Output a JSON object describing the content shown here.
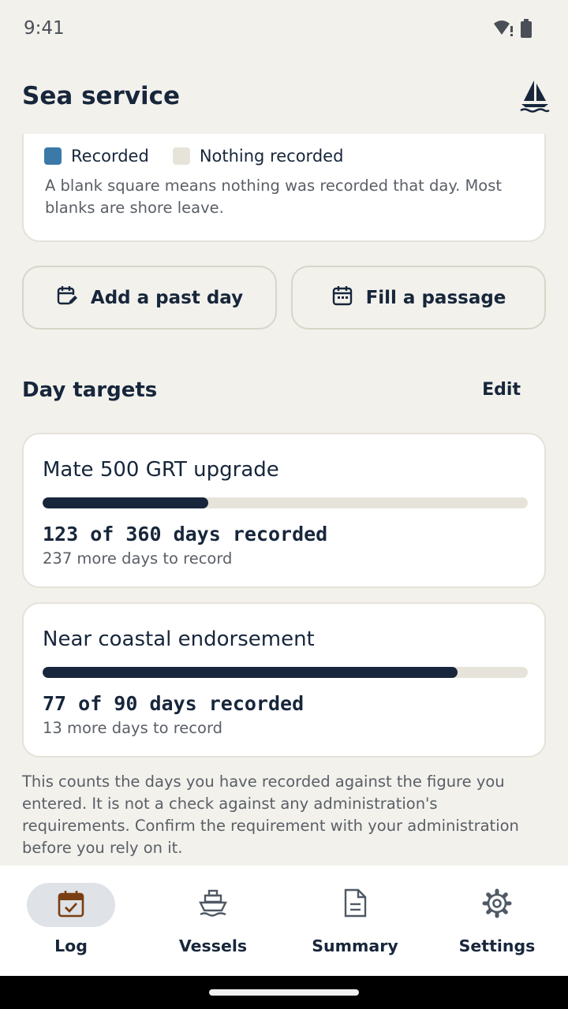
{
  "status_bar": {
    "time": "9:41"
  },
  "app_bar": {
    "title": "Sea service",
    "logo": "sailboat-icon"
  },
  "legend": {
    "recorded_label": "Recorded",
    "nothing_label": "Nothing recorded",
    "note": "A blank square means nothing was recorded that day. Most blanks are shore leave.",
    "recorded_color": "#3a79a8",
    "nothing_color": "#e6e4da"
  },
  "actions": {
    "add_past_day": "Add a past day",
    "fill_passage": "Fill a passage"
  },
  "targets_section": {
    "title": "Day targets",
    "edit_label": "Edit",
    "targets": [
      {
        "name": "Mate 500 GRT upgrade",
        "count_text": "123 of 360 days recorded",
        "remaining_text": "237 more days to record",
        "recorded": 123,
        "required": 360
      },
      {
        "name": "Near coastal endorsement",
        "count_text": "77 of 90 days recorded",
        "remaining_text": "13 more days to record",
        "recorded": 77,
        "required": 90
      }
    ]
  },
  "disclaimer": "This counts the days you have recorded against the figure you entered. It is not a check against any administration's requirements. Confirm the requirement with your administration before you rely on it.",
  "bottom_nav": {
    "items": [
      {
        "label": "Log",
        "icon": "calendar-check-icon",
        "active": true
      },
      {
        "label": "Vessels",
        "icon": "ship-icon",
        "active": false
      },
      {
        "label": "Summary",
        "icon": "document-icon",
        "active": false
      },
      {
        "label": "Settings",
        "icon": "gear-icon",
        "active": false
      }
    ]
  },
  "colors": {
    "primary": "#17263b",
    "background": "#f2f1ec",
    "active_icon": "#7a3e12"
  }
}
